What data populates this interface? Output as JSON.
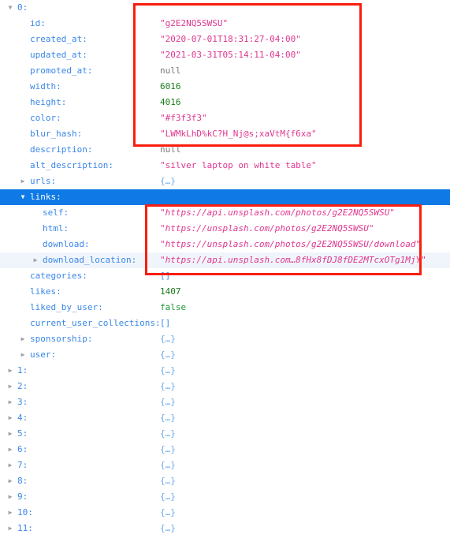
{
  "viewer": {
    "kind": "json-tree-viewer",
    "indent_label_separator": ":",
    "icons": {
      "expanded": "▼",
      "collapsed": "▶"
    },
    "colors": {
      "key": "#3a87e8",
      "string": "#e0368f",
      "number": "#1a7a1a",
      "boolean": "#1a9a3a",
      "null": "#787878",
      "object_placeholder": "#6aa8e8",
      "array_placeholder": "#3a87e8",
      "selection_background": "#0f7ae5",
      "hover_background": "#f0f5fb",
      "annotation_box": "#fa1d0d"
    },
    "placeholders": {
      "object": "{…}",
      "empty_array": "[]"
    }
  },
  "annotations": [
    {
      "name": "photo-metadata-highlight",
      "targets": "id through blur_hash values"
    },
    {
      "name": "links-urls-highlight",
      "targets": "self, html, download, download_location values"
    }
  ],
  "rows": [
    {
      "indent": 0,
      "twisty": "expanded",
      "key": "0:",
      "value": "",
      "type": "none",
      "state": "normal"
    },
    {
      "indent": 1,
      "twisty": "none",
      "key": "id:",
      "value": "\"g2E2NQ5SWSU\"",
      "type": "string",
      "state": "normal"
    },
    {
      "indent": 1,
      "twisty": "none",
      "key": "created_at:",
      "value": "\"2020-07-01T18:31:27-04:00\"",
      "type": "string",
      "state": "normal"
    },
    {
      "indent": 1,
      "twisty": "none",
      "key": "updated_at:",
      "value": "\"2021-03-31T05:14:11-04:00\"",
      "type": "string",
      "state": "normal"
    },
    {
      "indent": 1,
      "twisty": "none",
      "key": "promoted_at:",
      "value": "null",
      "type": "null",
      "state": "normal"
    },
    {
      "indent": 1,
      "twisty": "none",
      "key": "width:",
      "value": "6016",
      "type": "number",
      "state": "normal"
    },
    {
      "indent": 1,
      "twisty": "none",
      "key": "height:",
      "value": "4016",
      "type": "number",
      "state": "normal"
    },
    {
      "indent": 1,
      "twisty": "none",
      "key": "color:",
      "value": "\"#f3f3f3\"",
      "type": "string",
      "state": "normal"
    },
    {
      "indent": 1,
      "twisty": "none",
      "key": "blur_hash:",
      "value": "\"LWMkLhD%kC?H_Nj@s;xaVtM{f6xa\"",
      "type": "string",
      "state": "normal"
    },
    {
      "indent": 1,
      "twisty": "none",
      "key": "description:",
      "value": "null",
      "type": "null",
      "state": "normal"
    },
    {
      "indent": 1,
      "twisty": "none",
      "key": "alt_description:",
      "value": "\"silver laptop on white table\"",
      "type": "string",
      "state": "normal"
    },
    {
      "indent": 1,
      "twisty": "collapsed",
      "key": "urls:",
      "value": "{…}",
      "type": "object",
      "state": "normal"
    },
    {
      "indent": 1,
      "twisty": "expanded",
      "key": "links:",
      "value": "",
      "type": "none",
      "state": "selected"
    },
    {
      "indent": 2,
      "twisty": "none",
      "key": "self:",
      "value": "\"https://api.unsplash.com/photos/g2E2NQ5SWSU\"",
      "type": "url",
      "state": "normal"
    },
    {
      "indent": 2,
      "twisty": "none",
      "key": "html:",
      "value": "\"https://unsplash.com/photos/g2E2NQ5SWSU\"",
      "type": "url",
      "state": "normal"
    },
    {
      "indent": 2,
      "twisty": "none",
      "key": "download:",
      "value": "\"https://unsplash.com/photos/g2E2NQ5SWSU/download\"",
      "type": "url",
      "state": "normal"
    },
    {
      "indent": 2,
      "twisty": "collapsed",
      "key": "download_location:",
      "value": "\"https://api.unsplash.com…8fHx8fDJ8fDE2MTcxOTg1MjY\"",
      "type": "url",
      "state": "hover"
    },
    {
      "indent": 1,
      "twisty": "none",
      "key": "categories:",
      "value": "[]",
      "type": "array",
      "state": "normal"
    },
    {
      "indent": 1,
      "twisty": "none",
      "key": "likes:",
      "value": "1407",
      "type": "number",
      "state": "normal"
    },
    {
      "indent": 1,
      "twisty": "none",
      "key": "liked_by_user:",
      "value": "false",
      "type": "bool",
      "state": "normal"
    },
    {
      "indent": 1,
      "twisty": "none",
      "key": "current_user_collections:",
      "value": "[]",
      "type": "array",
      "state": "normal"
    },
    {
      "indent": 1,
      "twisty": "collapsed",
      "key": "sponsorship:",
      "value": "{…}",
      "type": "object",
      "state": "normal"
    },
    {
      "indent": 1,
      "twisty": "collapsed",
      "key": "user:",
      "value": "{…}",
      "type": "object",
      "state": "normal"
    },
    {
      "indent": 0,
      "twisty": "collapsed",
      "key": "1:",
      "value": "{…}",
      "type": "object",
      "state": "normal"
    },
    {
      "indent": 0,
      "twisty": "collapsed",
      "key": "2:",
      "value": "{…}",
      "type": "object",
      "state": "normal"
    },
    {
      "indent": 0,
      "twisty": "collapsed",
      "key": "3:",
      "value": "{…}",
      "type": "object",
      "state": "normal"
    },
    {
      "indent": 0,
      "twisty": "collapsed",
      "key": "4:",
      "value": "{…}",
      "type": "object",
      "state": "normal"
    },
    {
      "indent": 0,
      "twisty": "collapsed",
      "key": "5:",
      "value": "{…}",
      "type": "object",
      "state": "normal"
    },
    {
      "indent": 0,
      "twisty": "collapsed",
      "key": "6:",
      "value": "{…}",
      "type": "object",
      "state": "normal"
    },
    {
      "indent": 0,
      "twisty": "collapsed",
      "key": "7:",
      "value": "{…}",
      "type": "object",
      "state": "normal"
    },
    {
      "indent": 0,
      "twisty": "collapsed",
      "key": "8:",
      "value": "{…}",
      "type": "object",
      "state": "normal"
    },
    {
      "indent": 0,
      "twisty": "collapsed",
      "key": "9:",
      "value": "{…}",
      "type": "object",
      "state": "normal"
    },
    {
      "indent": 0,
      "twisty": "collapsed",
      "key": "10:",
      "value": "{…}",
      "type": "object",
      "state": "normal"
    },
    {
      "indent": 0,
      "twisty": "collapsed",
      "key": "11:",
      "value": "{…}",
      "type": "object",
      "state": "normal"
    }
  ]
}
